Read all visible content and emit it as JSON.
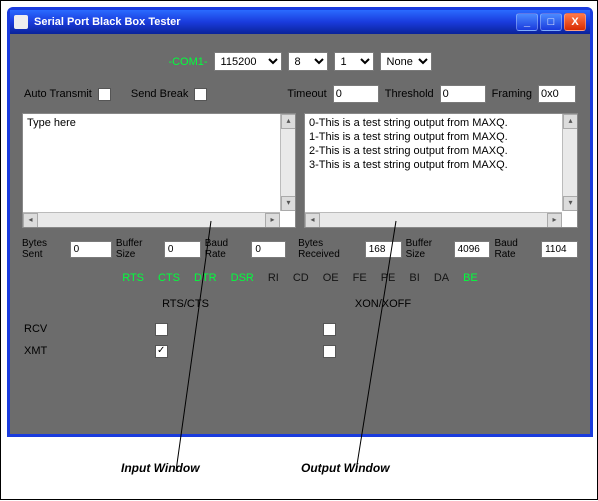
{
  "window": {
    "title": "Serial Port Black Box Tester"
  },
  "config": {
    "port_label": "-COM1-",
    "baud": "115200",
    "databits": "8",
    "stopbits": "1",
    "parity": "None",
    "auto_transmit_label": "Auto Transmit",
    "send_break_label": "Send Break",
    "timeout_label": "Timeout",
    "timeout_value": "0",
    "threshold_label": "Threshold",
    "threshold_value": "0",
    "framing_label": "Framing",
    "framing_value": "0x0"
  },
  "input": {
    "placeholder": "Type here"
  },
  "output": {
    "lines": [
      "0-This is a test string output from MAXQ.",
      "1-This is a test string output from MAXQ.",
      "2-This is a test string output from MAXQ.",
      "3-This is a test string output from MAXQ."
    ]
  },
  "stats": {
    "bytes_sent_label": "Bytes Sent",
    "bytes_sent": "0",
    "buf_size_in_label": "Buffer Size",
    "buf_size_in": "0",
    "baud_in_label": "Baud Rate",
    "baud_in": "0",
    "bytes_recv_label": "Bytes Received",
    "bytes_recv": "168",
    "buf_size_out_label": "Buffer Size",
    "buf_size_out": "4096",
    "baud_out_label": "Baud Rate",
    "baud_out": "1104"
  },
  "indicators": {
    "RTS": true,
    "CTS": true,
    "DTR": true,
    "DSR": true,
    "RI": false,
    "CD": false,
    "OE": false,
    "FE": false,
    "PE": false,
    "BI": false,
    "DA": false,
    "BE": true
  },
  "flow": {
    "rtscts_label": "RTS/CTS",
    "xonxoff_label": "XON/XOFF",
    "rcv_label": "RCV",
    "xmt_label": "XMT"
  },
  "annotations": {
    "input_window": "Input Window",
    "output_window": "Output Window"
  }
}
